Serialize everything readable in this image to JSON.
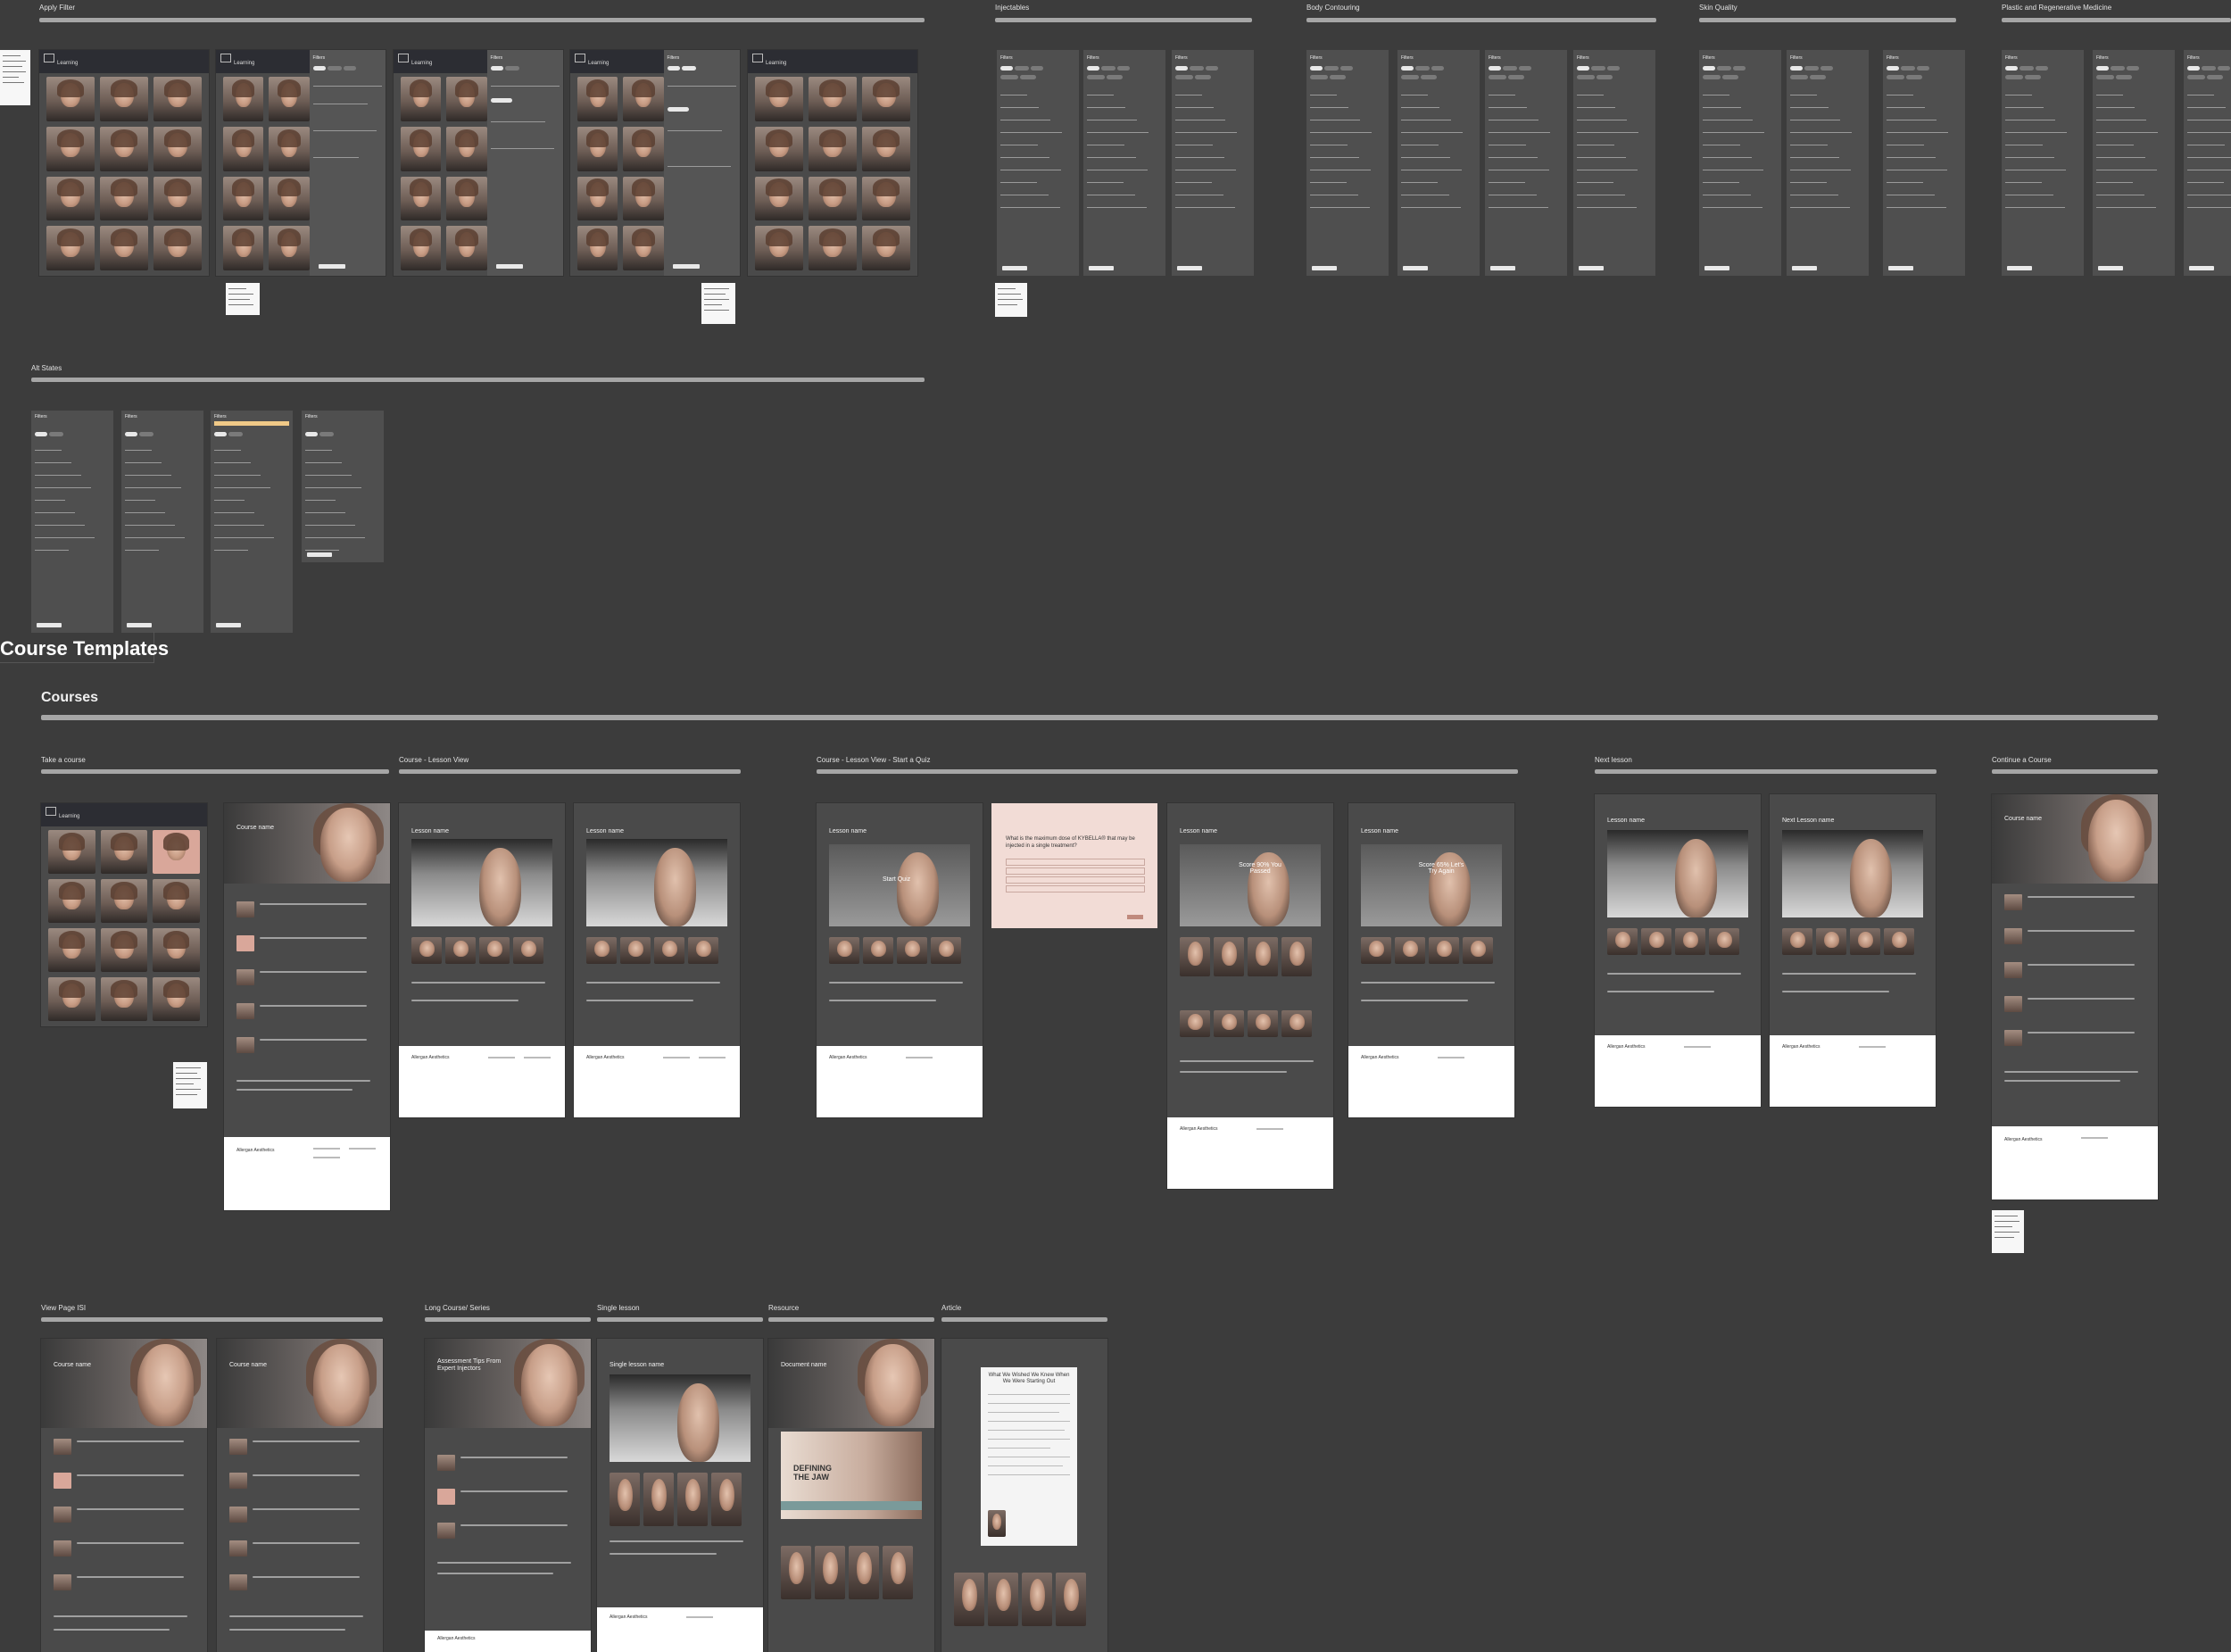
{
  "sections": {
    "apply_filter": "Apply Filter",
    "injectables": "Injectables",
    "body_contouring": "Body Contouring",
    "skin_quality": "Skin Quality",
    "plastic_regen": "Plastic and Regenerative Medicine",
    "alt_states": "Alt States",
    "course_templates": "Course Templates",
    "courses": "Courses",
    "take_a_course": "Take a course",
    "lesson_view": "Course - Lesson View",
    "lesson_quiz": "Course - Lesson View - Start a Quiz",
    "next_lesson": "Next lesson",
    "continue_course": "Continue a Course",
    "view_page_isi": "View Page ISI",
    "long_course": "Long Course/ Series",
    "single_lesson": "Single lesson",
    "resource": "Resource",
    "article": "Article"
  },
  "screens": {
    "app_title": "Learning",
    "filters_title": "Filters",
    "course_name": "Course name",
    "lesson_name": "Lesson name",
    "next_lesson_name": "Next Lesson name",
    "single_lesson_name": "Single lesson name",
    "document_name": "Document name",
    "start_quiz": "Start Quiz",
    "quiz_question": "What is the maximum dose of KYBELLA® that may be injected in a single treatment?",
    "score_pass": "Score 90% You Passed",
    "score_fail": "Score 65% Let's Try Again",
    "long_course_title": "Assessment Tips From Expert Injectors",
    "article_title": "What We Wished We Knew When We Were Starting Out",
    "defining_jaw": "DEFINING THE JAW",
    "brand": "Allergan Aesthetics"
  },
  "colors": {
    "background": "#3c3c3c",
    "frame": "#4a4a4a",
    "footer": "#ffffff",
    "accent_pink": "#d9a79a",
    "quiz_pink": "#f2dcd6"
  }
}
